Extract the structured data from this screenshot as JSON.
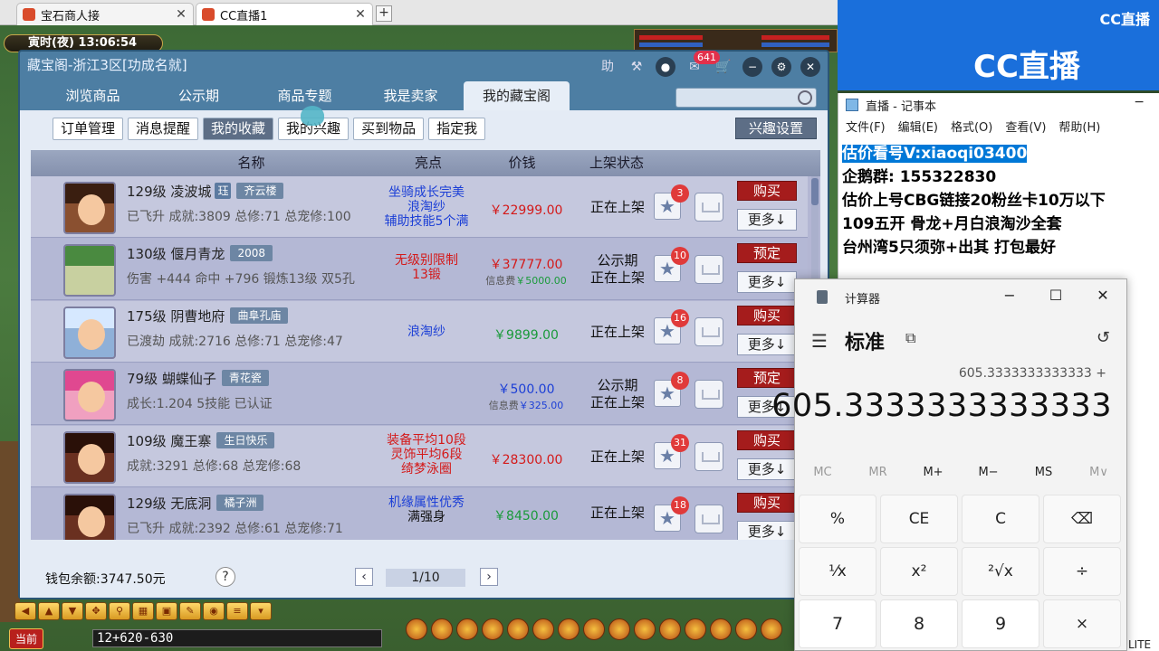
{
  "browser": {
    "tabs": [
      {
        "label": "宝石商人接"
      },
      {
        "label": "CC直播1"
      }
    ]
  },
  "game": {
    "time": "寅时(夜) 13:06:54",
    "chat_channel": "当前",
    "chat_input": "12+620-630"
  },
  "dialog": {
    "title": "藏宝阁-浙江3区[功成名就]",
    "help_label": "助",
    "message_count": "641",
    "nav_tabs": [
      "浏览商品",
      "公示期",
      "商品专题",
      "我是卖家",
      "我的藏宝阁"
    ],
    "sub_tabs": [
      "订单管理",
      "消息提醒",
      "我的收藏",
      "我的兴趣",
      "买到物品",
      "指定我"
    ],
    "interest_settings": "兴趣设置",
    "columns": {
      "name": "名称",
      "highlight": "亮点",
      "price": "价钱",
      "status": "上架状态"
    },
    "rows": [
      {
        "level": "129级",
        "server": "凌波城",
        "small_tag": "珏",
        "tag": "齐云楼",
        "desc": "已飞升 成就:3809 总修:71 总宠修:100",
        "highlights": [
          "坐骑成长完美",
          "浪淘纱",
          "辅助技能5个满"
        ],
        "highlight_color": "#1c3fd6",
        "price": "￥22999.00",
        "price_color": "#d41a1a",
        "fee": "",
        "status": [
          "正在上架"
        ],
        "fav": "3",
        "action": "购买",
        "more": "更多↓"
      },
      {
        "level": "130级",
        "server": "偃月青龙",
        "small_tag": "",
        "tag": "2008",
        "desc": "伤害 +444 命中 +796 锻炼13级 双5孔",
        "highlights": [
          "无级别限制",
          "13锻"
        ],
        "highlight_color": "#d41a1a",
        "price": "￥37777.00",
        "price_color": "#d41a1a",
        "fee": "信息费",
        "fee_value": "￥5000.00",
        "status": [
          "公示期",
          "正在上架"
        ],
        "fav": "10",
        "action": "预定",
        "more": "更多↓"
      },
      {
        "level": "175级",
        "server": "阴曹地府",
        "small_tag": "",
        "tag": "曲阜孔庙",
        "desc": "已渡劫 成就:2716 总修:71 总宠修:47",
        "highlights": [
          "浪淘纱"
        ],
        "highlight_color": "#1c3fd6",
        "price": "￥9899.00",
        "price_color": "#1a9a3a",
        "fee": "",
        "status": [
          "正在上架"
        ],
        "fav": "16",
        "action": "购买",
        "more": "更多↓"
      },
      {
        "level": "79级",
        "server": "蝴蝶仙子",
        "small_tag": "",
        "tag": "青花瓷",
        "desc": "成长:1.204 5技能 已认证",
        "highlights": [],
        "highlight_color": "#1c3fd6",
        "price": "￥500.00",
        "price_color": "#1c3fd6",
        "fee": "信息费",
        "fee_value": "￥325.00",
        "status": [
          "公示期",
          "正在上架"
        ],
        "fav": "8",
        "action": "预定",
        "more": "更多↓"
      },
      {
        "level": "109级",
        "server": "魔王寨",
        "small_tag": "",
        "tag": "生日快乐",
        "desc": "成就:3291 总修:68 总宠修:68",
        "highlights": [
          "装备平均10段",
          "灵饰平均6段",
          "绮梦泳圈"
        ],
        "highlight_color": "#d41a1a",
        "price": "￥28300.00",
        "price_color": "#d41a1a",
        "fee": "",
        "status": [
          "正在上架"
        ],
        "fav": "31",
        "action": "购买",
        "more": "更多↓"
      },
      {
        "level": "129级",
        "server": "无底洞",
        "small_tag": "",
        "tag": "橘子洲",
        "desc": "已飞升 成就:2392 总修:61 总宠修:71",
        "highlights": [
          "机缘属性优秀",
          "满强身"
        ],
        "highlight_color": "#1c3fd6",
        "price": "￥8450.00",
        "price_color": "#1a9a3a",
        "fee": "",
        "status": [
          "正在上架"
        ],
        "fav": "18",
        "action": "购买",
        "more": "更多↓"
      }
    ],
    "wallet_label": "钱包余额:",
    "wallet_value": "3747.50元",
    "help_q": "?",
    "page": "1/10"
  },
  "cc": {
    "brand": "CC直播"
  },
  "notepad": {
    "title": "直播 - 记事本",
    "menu": [
      "文件(F)",
      "编辑(E)",
      "格式(O)",
      "查看(V)",
      "帮助(H)"
    ],
    "lines": [
      "估价看号V:xiaoqi03400",
      "企鹅群: 155322830",
      "估价上号CBG链接20粉丝卡10万以下",
      "109五开 骨龙+月白浪淘沙全套",
      "台州湾5只须弥+出其 打包最好"
    ]
  },
  "calculator": {
    "app_title": "计算器",
    "mode": "标准",
    "expression": "605.3333333333333 +",
    "display": "605.3333333333333",
    "memory": [
      "MC",
      "MR",
      "M+",
      "M−",
      "MS",
      "M∨"
    ],
    "keys": [
      "%",
      "CE",
      "C",
      "⌫",
      "¹⁄x",
      "x²",
      "²√x",
      "÷",
      "7",
      "8",
      "9",
      "×"
    ]
  },
  "taskbar": {
    "lite": "LITE"
  }
}
